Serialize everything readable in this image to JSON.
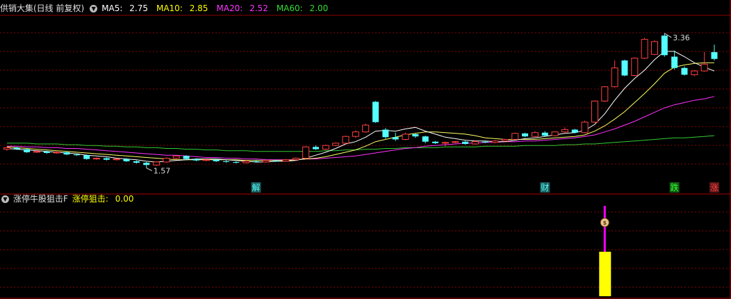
{
  "main_header": {
    "title": "供销大集(日线 前复权)",
    "toggle_icon": "chevron-down-icon",
    "ma": [
      {
        "label": "MA5:",
        "value": "2.75",
        "color": "#ffffff"
      },
      {
        "label": "MA10:",
        "value": "2.85",
        "color": "#ffff00"
      },
      {
        "label": "MA20:",
        "value": "2.52",
        "color": "#ff33ff"
      },
      {
        "label": "MA60:",
        "value": "2.00",
        "color": "#33dd33"
      }
    ]
  },
  "sub_header": {
    "title": "涨停牛股狙击F",
    "toggle_icon": "chevron-down-icon",
    "indicator_label": "涨停狙击:",
    "indicator_value": "0.00"
  },
  "colors": {
    "up": "#ff4040",
    "down": "#54ffff",
    "grid": "#8b0000",
    "ma5": "#ffffff",
    "ma10": "#ffff66",
    "ma20": "#ff33ff",
    "ma60": "#33cc33",
    "signal_bar": "#ffff00",
    "signal_line": "#ff00ff"
  },
  "chart_data": [
    {
      "type": "candlestick",
      "title": "供销大集(日线 前复权)",
      "ylim": [
        1.4,
        3.6
      ],
      "annotations": {
        "high": "3.36",
        "low": "1.57"
      },
      "event_markers": [
        {
          "label": "解",
          "index": 25,
          "color": "#54ffff"
        },
        {
          "label": "财",
          "index": 54,
          "color": "#54ffff"
        },
        {
          "label": "跌",
          "index": 67,
          "color": "#33ff33"
        },
        {
          "label": "涨",
          "index": 71,
          "color": "#ff4040"
        }
      ],
      "candles": [
        [
          1.82,
          1.84,
          1.8,
          1.85
        ],
        [
          1.84,
          1.82,
          1.81,
          1.85
        ],
        [
          1.82,
          1.78,
          1.77,
          1.83
        ],
        [
          1.78,
          1.79,
          1.77,
          1.81
        ],
        [
          1.79,
          1.77,
          1.76,
          1.8
        ],
        [
          1.77,
          1.78,
          1.76,
          1.79
        ],
        [
          1.78,
          1.75,
          1.74,
          1.79
        ],
        [
          1.75,
          1.74,
          1.73,
          1.76
        ],
        [
          1.74,
          1.69,
          1.68,
          1.75
        ],
        [
          1.69,
          1.7,
          1.68,
          1.71
        ],
        [
          1.7,
          1.68,
          1.67,
          1.71
        ],
        [
          1.68,
          1.69,
          1.67,
          1.7
        ],
        [
          1.69,
          1.66,
          1.65,
          1.7
        ],
        [
          1.66,
          1.64,
          1.63,
          1.67
        ],
        [
          1.64,
          1.61,
          1.57,
          1.65
        ],
        [
          1.61,
          1.65,
          1.6,
          1.66
        ],
        [
          1.65,
          1.7,
          1.64,
          1.71
        ],
        [
          1.7,
          1.73,
          1.69,
          1.74
        ],
        [
          1.73,
          1.69,
          1.68,
          1.74
        ],
        [
          1.69,
          1.67,
          1.66,
          1.7
        ],
        [
          1.67,
          1.68,
          1.66,
          1.69
        ],
        [
          1.68,
          1.66,
          1.65,
          1.69
        ],
        [
          1.66,
          1.65,
          1.64,
          1.67
        ],
        [
          1.65,
          1.64,
          1.63,
          1.66
        ],
        [
          1.64,
          1.66,
          1.63,
          1.67
        ],
        [
          1.66,
          1.65,
          1.64,
          1.68
        ],
        [
          1.65,
          1.67,
          1.64,
          1.68
        ],
        [
          1.67,
          1.66,
          1.65,
          1.68
        ],
        [
          1.66,
          1.68,
          1.65,
          1.69
        ],
        [
          1.68,
          1.7,
          1.67,
          1.71
        ],
        [
          1.7,
          1.85,
          1.69,
          1.86
        ],
        [
          1.85,
          1.82,
          1.81,
          1.87
        ],
        [
          1.82,
          1.87,
          1.81,
          1.88
        ],
        [
          1.87,
          1.9,
          1.86,
          1.91
        ],
        [
          1.9,
          1.99,
          1.89,
          2.0
        ],
        [
          1.99,
          2.05,
          1.97,
          2.07
        ],
        [
          2.05,
          2.14,
          2.04,
          2.16
        ],
        [
          2.45,
          2.18,
          2.17,
          2.46
        ],
        [
          2.08,
          1.98,
          1.96,
          2.1
        ],
        [
          1.98,
          1.95,
          1.93,
          2.04
        ],
        [
          1.95,
          2.02,
          1.94,
          2.04
        ],
        [
          2.02,
          1.99,
          1.97,
          2.03
        ],
        [
          1.99,
          1.92,
          1.9,
          2.0
        ],
        [
          1.92,
          1.9,
          1.89,
          1.93
        ],
        [
          1.9,
          1.91,
          1.86,
          1.92
        ],
        [
          1.91,
          1.92,
          1.9,
          1.93
        ],
        [
          1.92,
          1.89,
          1.88,
          1.93
        ],
        [
          1.89,
          1.92,
          1.88,
          1.94
        ],
        [
          1.92,
          1.91,
          1.9,
          1.93
        ],
        [
          1.91,
          1.93,
          1.9,
          1.94
        ],
        [
          1.93,
          1.95,
          1.92,
          1.96
        ],
        [
          1.95,
          2.03,
          1.94,
          2.04
        ],
        [
          2.03,
          1.99,
          1.98,
          2.04
        ],
        [
          1.99,
          2.04,
          1.98,
          2.06
        ],
        [
          2.04,
          2.0,
          1.99,
          2.06
        ],
        [
          2.0,
          2.05,
          1.99,
          2.06
        ],
        [
          2.05,
          2.08,
          2.04,
          2.11
        ],
        [
          2.08,
          2.04,
          2.03,
          2.09
        ],
        [
          2.04,
          2.18,
          2.03,
          2.2
        ],
        [
          2.18,
          2.46,
          2.17,
          2.47
        ],
        [
          2.46,
          2.65,
          2.45,
          2.66
        ],
        [
          2.65,
          2.9,
          2.64,
          3.0
        ],
        [
          3.0,
          2.8,
          2.79,
          3.01
        ],
        [
          2.8,
          3.03,
          2.79,
          3.04
        ],
        [
          3.03,
          3.28,
          3.02,
          3.3
        ],
        [
          3.08,
          3.25,
          3.07,
          3.27
        ],
        [
          3.33,
          3.07,
          3.05,
          3.36
        ],
        [
          3.05,
          2.9,
          2.88,
          3.13
        ],
        [
          2.9,
          2.81,
          2.8,
          2.92
        ],
        [
          2.81,
          2.86,
          2.79,
          2.87
        ],
        [
          2.86,
          2.95,
          2.85,
          3.11
        ],
        [
          3.11,
          3.02,
          3.0,
          3.21
        ]
      ],
      "ma5": [
        1.83,
        1.82,
        1.81,
        1.8,
        1.79,
        1.78,
        1.77,
        1.76,
        1.74,
        1.73,
        1.72,
        1.7,
        1.69,
        1.68,
        1.66,
        1.65,
        1.66,
        1.67,
        1.68,
        1.69,
        1.69,
        1.69,
        1.68,
        1.67,
        1.66,
        1.65,
        1.65,
        1.66,
        1.66,
        1.67,
        1.7,
        1.74,
        1.78,
        1.83,
        1.89,
        1.92,
        1.98,
        2.06,
        2.07,
        2.06,
        2.09,
        2.11,
        2.06,
        2.02,
        1.98,
        1.96,
        1.94,
        1.93,
        1.93,
        1.92,
        1.92,
        1.94,
        1.96,
        1.97,
        1.99,
        2.01,
        2.03,
        2.04,
        2.07,
        2.15,
        2.29,
        2.47,
        2.63,
        2.76,
        2.87,
        3.01,
        3.12,
        3.12,
        3.05,
        2.97,
        2.91,
        2.86
      ],
      "ma10": [
        1.85,
        1.84,
        1.83,
        1.82,
        1.81,
        1.8,
        1.79,
        1.78,
        1.77,
        1.76,
        1.75,
        1.74,
        1.73,
        1.72,
        1.71,
        1.7,
        1.69,
        1.68,
        1.68,
        1.68,
        1.68,
        1.68,
        1.68,
        1.68,
        1.67,
        1.67,
        1.67,
        1.67,
        1.67,
        1.68,
        1.69,
        1.7,
        1.72,
        1.75,
        1.78,
        1.81,
        1.86,
        1.92,
        1.95,
        1.98,
        2.01,
        2.03,
        2.05,
        2.05,
        2.04,
        2.03,
        2.02,
        2.0,
        1.97,
        1.96,
        1.95,
        1.95,
        1.95,
        1.95,
        1.96,
        1.97,
        1.98,
        1.99,
        2.01,
        2.06,
        2.13,
        2.22,
        2.32,
        2.44,
        2.56,
        2.69,
        2.83,
        2.91,
        2.94,
        2.96,
        2.97,
        2.97
      ],
      "ma20": [
        1.86,
        1.86,
        1.85,
        1.85,
        1.84,
        1.84,
        1.83,
        1.83,
        1.82,
        1.81,
        1.8,
        1.79,
        1.78,
        1.77,
        1.76,
        1.75,
        1.74,
        1.74,
        1.73,
        1.72,
        1.71,
        1.71,
        1.7,
        1.7,
        1.69,
        1.69,
        1.68,
        1.68,
        1.68,
        1.68,
        1.69,
        1.69,
        1.7,
        1.71,
        1.72,
        1.73,
        1.75,
        1.77,
        1.79,
        1.81,
        1.83,
        1.84,
        1.86,
        1.87,
        1.88,
        1.89,
        1.9,
        1.9,
        1.91,
        1.91,
        1.92,
        1.92,
        1.93,
        1.93,
        1.94,
        1.95,
        1.96,
        1.97,
        1.99,
        2.01,
        2.05,
        2.09,
        2.14,
        2.19,
        2.25,
        2.31,
        2.37,
        2.41,
        2.44,
        2.47,
        2.49,
        2.52
      ],
      "ma60": [
        1.9,
        1.9,
        1.9,
        1.89,
        1.89,
        1.89,
        1.88,
        1.88,
        1.87,
        1.87,
        1.86,
        1.86,
        1.85,
        1.85,
        1.84,
        1.84,
        1.83,
        1.83,
        1.82,
        1.82,
        1.81,
        1.81,
        1.8,
        1.8,
        1.8,
        1.79,
        1.79,
        1.79,
        1.79,
        1.79,
        1.79,
        1.79,
        1.8,
        1.8,
        1.81,
        1.81,
        1.82,
        1.82,
        1.83,
        1.83,
        1.84,
        1.84,
        1.84,
        1.84,
        1.85,
        1.85,
        1.85,
        1.85,
        1.86,
        1.86,
        1.86,
        1.86,
        1.87,
        1.87,
        1.87,
        1.87,
        1.88,
        1.88,
        1.89,
        1.89,
        1.9,
        1.91,
        1.92,
        1.93,
        1.94,
        1.95,
        1.96,
        1.97,
        1.97,
        1.98,
        1.99,
        2.0
      ]
    },
    {
      "type": "bar",
      "title": "涨停牛股狙击F",
      "series": [
        {
          "name": "涨停狙击",
          "signal_index": 60,
          "value": 1
        }
      ]
    }
  ]
}
